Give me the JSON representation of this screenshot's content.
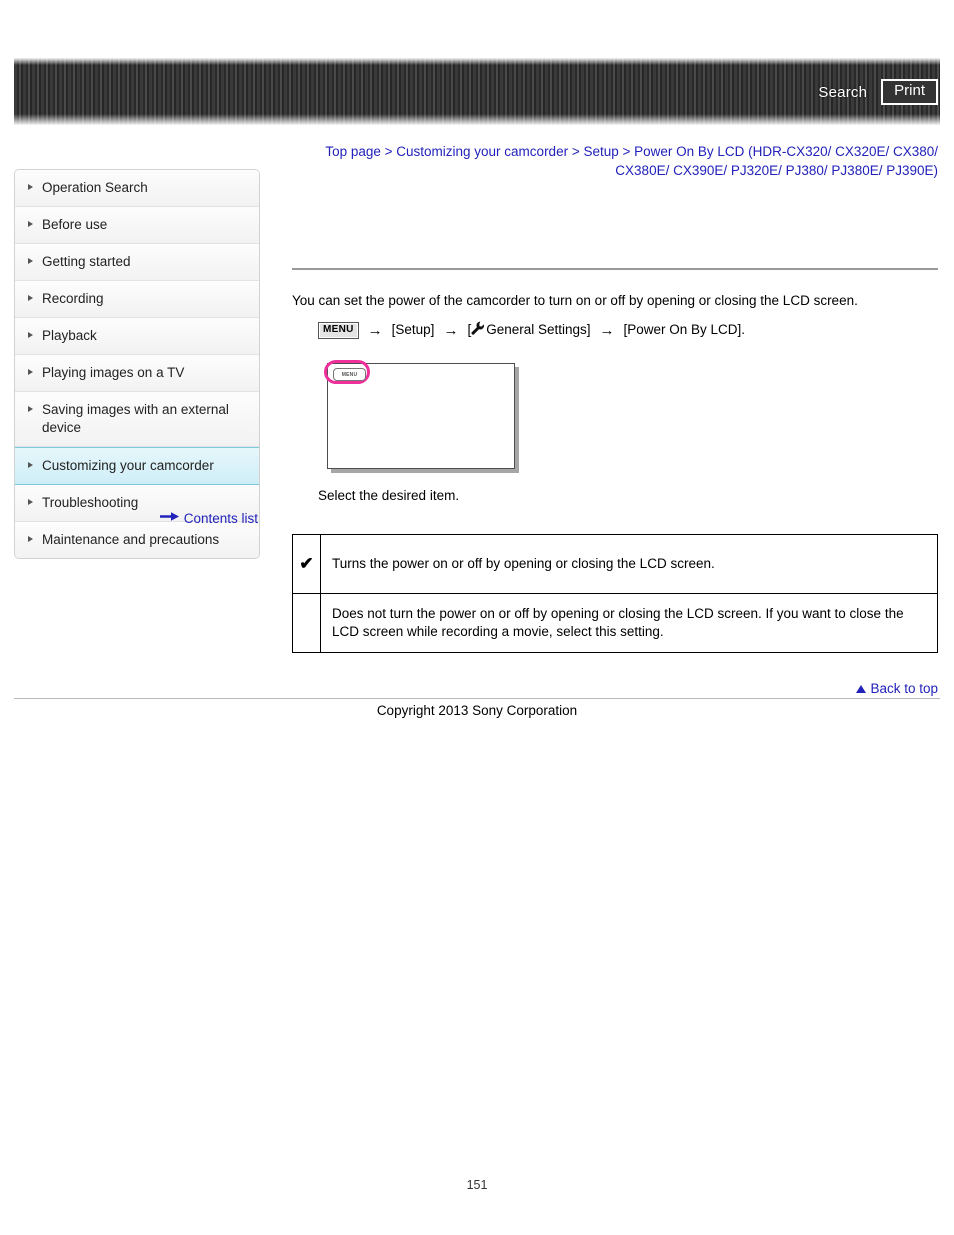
{
  "header": {
    "search_label": "Search",
    "print_label": "Print"
  },
  "breadcrumb": {
    "items": [
      "Top page",
      "Customizing your camcorder",
      "Setup",
      "Power On By LCD (HDR-CX320/ CX320E/ CX380/ CX380E/ CX390E/ PJ320E/ PJ380/ PJ380E/ PJ390E)"
    ],
    "separator": ">",
    "line1": "Top page > Customizing your camcorder > Setup > Power On By LCD (HDR-CX320/ CX320E/ CX380/",
    "line2": "CX380E/ CX390E/ PJ320E/ PJ380/ PJ380E/ PJ390E)"
  },
  "sidebar": {
    "items": [
      {
        "label": "Operation Search",
        "active": false
      },
      {
        "label": "Before use",
        "active": false
      },
      {
        "label": "Getting started",
        "active": false
      },
      {
        "label": "Recording",
        "active": false
      },
      {
        "label": "Playback",
        "active": false
      },
      {
        "label": "Playing images on a TV",
        "active": false
      },
      {
        "label": "Saving images with an external device",
        "active": false
      },
      {
        "label": "Customizing your camcorder",
        "active": true
      },
      {
        "label": "Troubleshooting",
        "active": false
      },
      {
        "label": "Maintenance and precautions",
        "active": false
      }
    ],
    "contents_list_label": "Contents list"
  },
  "main": {
    "intro": "You can set the power of the camcorder to turn on or off by opening or closing the LCD screen.",
    "path": {
      "menu_chip": "MENU",
      "arrow": "→",
      "step1": "[Setup]",
      "step2": "General Settings]",
      "step2_prefix": "[",
      "step3": "[Power On By LCD]."
    },
    "illustration": {
      "menu_button_label": "MENU",
      "highlight_color": "#ef2f9a"
    },
    "select_caption": "Select the desired item.",
    "options": [
      {
        "checked": true,
        "check_glyph": "✔",
        "description": "Turns the power on or off by opening or closing the LCD screen."
      },
      {
        "checked": false,
        "check_glyph": "",
        "description": "Does not turn the power on or off by opening or closing the LCD screen. If you want to close the LCD screen while recording a movie, select this setting."
      }
    ]
  },
  "footer": {
    "back_to_top_label": "Back to top",
    "copyright": "Copyright 2013 Sony Corporation",
    "page_number": "151"
  }
}
